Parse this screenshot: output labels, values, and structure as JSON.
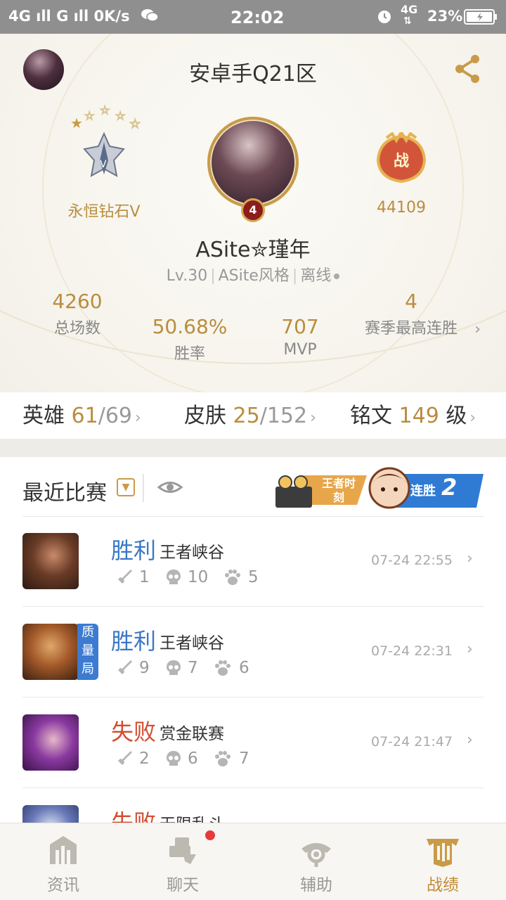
{
  "status_bar": {
    "left": "4G ıll  G ıll  0K/s",
    "time": "22:02",
    "network": "4G",
    "battery": "23%"
  },
  "header": {
    "server": "安卓手Q21区",
    "rank": "永恒钻石V",
    "battle_power": "44109",
    "level_badge": "4",
    "player_name": "ASite✮瑾年",
    "level": "Lv.30",
    "style": "ASite风格",
    "status": "离线"
  },
  "stats": {
    "total_matches": {
      "value": "4260",
      "label": "总场数"
    },
    "win_rate": {
      "value": "50.68%",
      "label": "胜率"
    },
    "mvp": {
      "value": "707",
      "label": "MVP"
    },
    "best_streak": {
      "value": "4",
      "label": "赛季最高连胜"
    }
  },
  "collection": {
    "heroes": {
      "label": "英雄",
      "owned": "61",
      "total": "/69"
    },
    "skins": {
      "label": "皮肤",
      "owned": "25",
      "total": "/152"
    },
    "inscriptions": {
      "label": "铭文",
      "owned": "149",
      "suffix": "级"
    }
  },
  "recent": {
    "title": "最近比赛",
    "moments_label": "王者时刻",
    "streak_label": "连胜",
    "streak_count": "2",
    "matches": [
      {
        "result": "胜利",
        "mode": "王者峡谷",
        "kills": "1",
        "deaths": "10",
        "assists": "5",
        "time": "07-24 22:55"
      },
      {
        "result": "胜利",
        "mode": "王者峡谷",
        "kills": "9",
        "deaths": "7",
        "assists": "6",
        "time": "07-24 22:31",
        "tag": "质量局"
      },
      {
        "result": "失败",
        "mode": "赏金联赛",
        "kills": "2",
        "deaths": "6",
        "assists": "7",
        "time": "07-24 21:47"
      },
      {
        "result": "失败",
        "mode": "无限乱斗"
      }
    ]
  },
  "nav": {
    "items": [
      {
        "label": "资讯",
        "icon": "news-icon"
      },
      {
        "label": "聊天",
        "icon": "chat-icon"
      },
      {
        "label": "辅助",
        "icon": "assist-icon"
      },
      {
        "label": "战绩",
        "icon": "record-icon"
      }
    ]
  },
  "colors": {
    "gold": "#b98d3f",
    "win": "#3a78c6",
    "loss": "#d04d32",
    "accent": "#c08a35"
  }
}
